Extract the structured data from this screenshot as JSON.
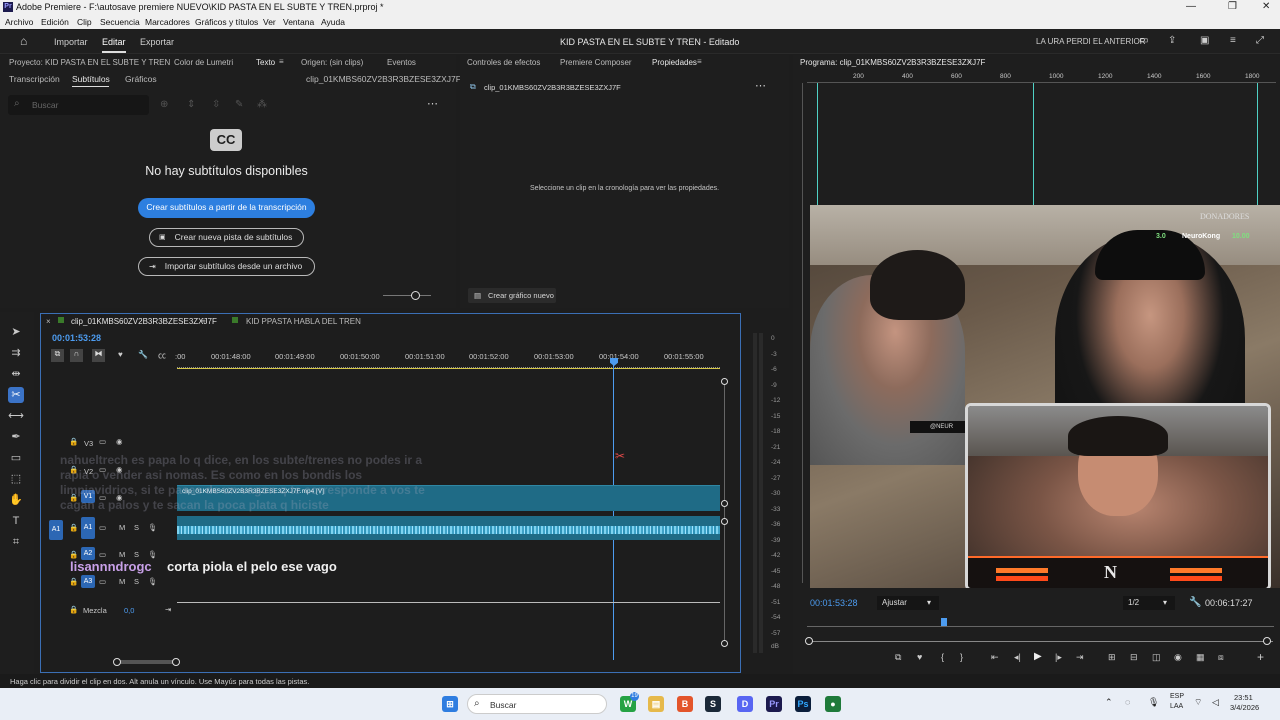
{
  "window": {
    "title": "Adobe Premiere - F:\\autosave premiere NUEVO\\KID PASTA EN EL SUBTE Y TREN.prproj *",
    "minimize": "—",
    "maximize": "❐",
    "close": "✕"
  },
  "menu": [
    "Archivo",
    "Edición",
    "Clip",
    "Secuencia",
    "Marcadores",
    "Gráficos y títulos",
    "Ver",
    "Ventana",
    "Ayuda"
  ],
  "header": {
    "import": "Importar",
    "edit": "Editar",
    "export": "Exportar",
    "project_title": "KID PASTA EN EL SUBTE Y TREN - Editado",
    "right_label": "LA URA PERDI EL ANTERIOR"
  },
  "left_panel": {
    "tabs": [
      "Proyecto: KID PASTA EN EL SUBTE Y TREN",
      "Color de Lumetri",
      "Texto",
      "Origen: (sin clips)",
      "Eventos"
    ],
    "subtabs": [
      "Transcripción",
      "Subtítulos",
      "Gráficos"
    ],
    "clip_name": "clip_01KMBS60ZV2B3R3BZESE3ZXJ7F",
    "search_placeholder": "Buscar",
    "cc": "CC",
    "no_captions": "No hay subtítulos disponibles",
    "btn_create_from_transcript": "Crear subtítulos a partir de la transcripción",
    "btn_new_track": "Crear nueva pista de subtítulos",
    "btn_import": "Importar subtítulos desde un archivo"
  },
  "mid_panel": {
    "tabs": [
      "Controles de efectos",
      "Premiere Composer",
      "Propiedades"
    ],
    "clip_name": "clip_01KMBS60ZV2B3R3BZESE3ZXJ7F",
    "message": "Seleccione un clip en la cronología para ver las propiedades.",
    "new_graphic": "Crear gráfico nuevo"
  },
  "program": {
    "title": "Programa: clip_01KMBS60ZV2B3R3BZESE3ZXJ7F",
    "ruler": [
      "200",
      "400",
      "600",
      "800",
      "1000",
      "1200",
      "1400",
      "1600",
      "1800"
    ],
    "timecode": "00:01:53:28",
    "fit": "Ajustar",
    "res": "1/2",
    "duration": "00:06:17:27",
    "overlay": {
      "donors": "DONADORES",
      "donor_amount_left": "3.0",
      "donor_name": "NeuroKong",
      "donor_amount": "10.00",
      "logo": "N",
      "badge": "@NEUR"
    }
  },
  "timeline": {
    "tabs": [
      "clip_01KMBS60ZV2B3R3BZESE3ZXJ7F",
      "KID PPASTA HABLA DEL TREN"
    ],
    "timecode": "00:01:53:28",
    "ruler": [
      "00:01:48:00",
      "00:01:49:00",
      "00:01:50:00",
      "00:01:51:00",
      "00:01:52:00",
      "00:01:53:00",
      "00:01:54:00",
      "00:01:55:00"
    ],
    "ruler_start": ":00",
    "tracks": [
      "V3",
      "V2",
      "V1",
      "A1",
      "A2",
      "A3"
    ],
    "source_a1": "A1",
    "mix": "Mezcla",
    "mix_value": "0,0",
    "clip_label": "clip_01KMBS60ZV2B3R3BZESE3ZXJ7F.mp4 [V]"
  },
  "meter": [
    "0",
    "-3",
    "-6",
    "-9",
    "-12",
    "-15",
    "-18",
    "-21",
    "-24",
    "-27",
    "-30",
    "-33",
    "-36",
    "-39",
    "-42",
    "-45",
    "-48",
    "-51",
    "-54",
    "-57",
    "dB"
  ],
  "chat": [
    {
      "user": "nahueltrech",
      "text": "es papa lo q dice, en los subte/trenes no podes ir a rapia o vender asi nomas. Es como en los bondis los limpiavidrios, si te pasas de un vagon q te corresponde a vos te cagan a palos y te sacan la poca plata q hiciste"
    },
    {
      "user": "lisannndrogc",
      "text": "corta piola el pelo ese vago"
    }
  ],
  "status": "Haga clic para dividir el clip en dos. Alt anula un vínculo. Use Mayús para todas las pistas.",
  "taskbar": {
    "search": "Buscar",
    "badge": "19",
    "lang": "ESP",
    "lang2": "LAA",
    "time": "23:51",
    "date": "3/4/2026"
  }
}
